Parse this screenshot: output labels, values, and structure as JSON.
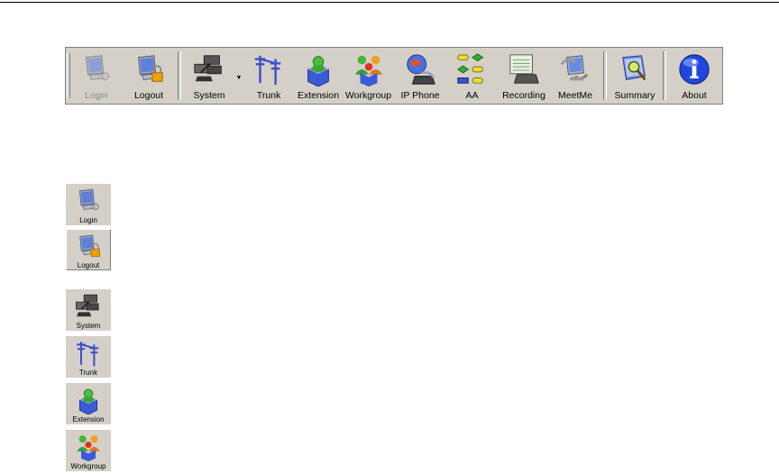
{
  "toolbar": {
    "items": [
      {
        "label": "Login",
        "icon": "login-icon",
        "enabled": false
      },
      {
        "label": "Logout",
        "icon": "logout-icon",
        "enabled": true
      },
      {
        "label": "System",
        "icon": "system-icon",
        "enabled": true
      },
      {
        "label": "Trunk",
        "icon": "trunk-icon",
        "enabled": true
      },
      {
        "label": "Extension",
        "icon": "extension-icon",
        "enabled": true
      },
      {
        "label": "Workgroup",
        "icon": "workgroup-icon",
        "enabled": true
      },
      {
        "label": "IP Phone",
        "icon": "ip-phone-icon",
        "enabled": true
      },
      {
        "label": "AA",
        "icon": "aa-icon",
        "enabled": true
      },
      {
        "label": "Recording",
        "icon": "recording-icon",
        "enabled": true
      },
      {
        "label": "MeetMe",
        "icon": "meetme-icon",
        "enabled": true
      },
      {
        "label": "Summary",
        "icon": "summary-icon",
        "enabled": true
      },
      {
        "label": "About",
        "icon": "about-icon",
        "enabled": true
      }
    ]
  },
  "side_buttons": [
    {
      "label": "Login",
      "icon": "login-icon"
    },
    {
      "label": "Logout",
      "icon": "logout-icon"
    },
    {
      "label": "System",
      "icon": "system-icon"
    },
    {
      "label": "Trunk",
      "icon": "trunk-icon"
    },
    {
      "label": "Extension",
      "icon": "extension-icon"
    },
    {
      "label": "Workgroup",
      "icon": "workgroup-icon"
    }
  ],
  "colors": {
    "toolbar_bg": "#d4d0c8",
    "accent_blue": "#1a3fd0",
    "disabled_text": "#8a8a8a"
  }
}
